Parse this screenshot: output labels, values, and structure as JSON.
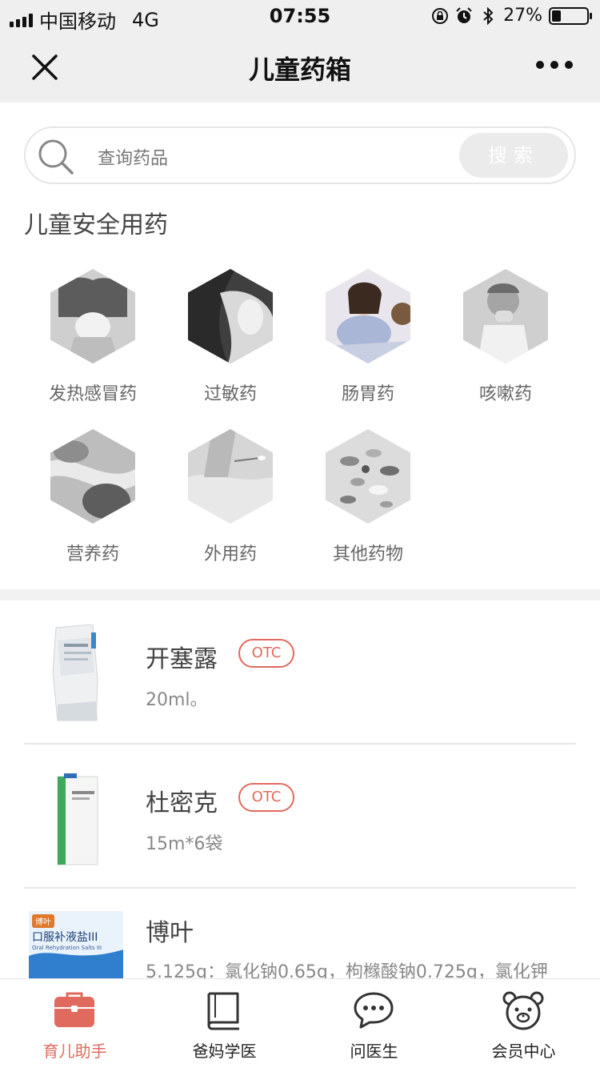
{
  "status_bar": {
    "carrier": "中国移动",
    "network": "4G",
    "time": "07:55",
    "battery": "27%",
    "battery_level": 0.27,
    "icons": [
      "signal-icon",
      "rotation-lock-icon",
      "alarm-icon",
      "bluetooth-icon",
      "battery-icon"
    ]
  },
  "nav": {
    "title": "儿童药箱",
    "close_icon": "close-icon",
    "more_icon": "more-icon"
  },
  "search": {
    "placeholder": "查询药品",
    "button": "搜索"
  },
  "section_title": "儿童安全用药",
  "categories": [
    {
      "label": "发热感冒药",
      "active": false
    },
    {
      "label": "过敏药",
      "active": false
    },
    {
      "label": "肠胃药",
      "active": true
    },
    {
      "label": "咳嗽药",
      "active": false
    },
    {
      "label": "营养药",
      "active": false
    },
    {
      "label": "外用药",
      "active": false
    },
    {
      "label": "其他药物",
      "active": false
    }
  ],
  "drugs": [
    {
      "name": "开塞露",
      "badge": "OTC",
      "spec": "20ml。"
    },
    {
      "name": "杜密克",
      "badge": "OTC",
      "spec": "15m*6袋"
    },
    {
      "name": "博叶",
      "badge": "",
      "spec": "5.125g：氯化钠0.65g，枸橼酸钠0.725g，氯化钾"
    }
  ],
  "drug3_packaging": {
    "brand": "博叶",
    "product": "口服补液盐III",
    "english": "Oral Rehydration Salts III"
  },
  "tabs": [
    {
      "label": "育儿助手",
      "icon": "medicine-box-icon",
      "active": true
    },
    {
      "label": "爸妈学医",
      "icon": "book-icon",
      "active": false
    },
    {
      "label": "问医生",
      "icon": "chat-icon",
      "active": false
    },
    {
      "label": "会员中心",
      "icon": "bear-icon",
      "active": false
    }
  ],
  "colors": {
    "accent": "#e06a5d",
    "bar_bg": "#efefef",
    "divider": "#e6e6e6"
  }
}
